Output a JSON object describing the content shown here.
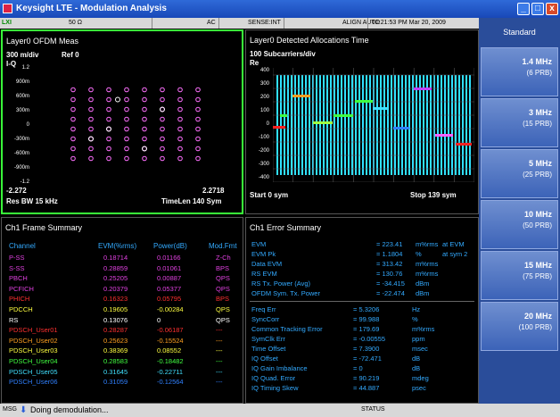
{
  "title": "Keysight LTE - Modulation Analysis",
  "status_bar": {
    "indicator": "LXI",
    "impedance": "50 Ω",
    "coupling": "AC",
    "sense": "SENSE:INT",
    "align": "ALIGN AUTO",
    "datetime": "01:21:53 PM Mar 20, 2009"
  },
  "window_buttons": [
    "_",
    "□",
    "x"
  ],
  "panel1": {
    "title": "Layer0 OFDM Meas",
    "scale": "300 m/div",
    "ref": "Ref 0",
    "axis": "I-Q",
    "yticks": [
      "1.2",
      "900m",
      "600m",
      "300m",
      "0",
      "-300m",
      "-600m",
      "-900m",
      "-1.2"
    ],
    "x_start": "-2.272",
    "x_stop": "2.2718",
    "res_bw": "Res BW 15 kHz",
    "time_len": "TimeLen 140  Sym"
  },
  "panel2": {
    "title": "Layer0 Detected Allocations Time",
    "scale": "100  Subcarriers/div",
    "axis": "Re",
    "yticks": [
      "400",
      "300",
      "200",
      "100",
      "0",
      "-100",
      "-200",
      "-300",
      "-400"
    ],
    "start": "Start 0  sym",
    "stop": "Stop 139  sym"
  },
  "panel3": {
    "title": "Ch1 Frame Summary",
    "headers": [
      "Channel",
      "EVM(%rms)",
      "Power(dB)",
      "Mod.Fmt"
    ],
    "rows": [
      {
        "channel": "P-SS",
        "evm": "0.18714",
        "power": "0.01166",
        "mod": "Z-Ch",
        "color": "#e040e0"
      },
      {
        "channel": "S-SS",
        "evm": "0.28859",
        "power": "0.01061",
        "mod": "BPS",
        "color": "#e040e0"
      },
      {
        "channel": "PBCH",
        "evm": "0.25205",
        "power": "0.00887",
        "mod": "QPS",
        "color": "#e040e0"
      },
      {
        "channel": "PCFICH",
        "evm": "0.20379",
        "power": "0.05377",
        "mod": "QPS",
        "color": "#e040e0"
      },
      {
        "channel": "PHICH",
        "evm": "0.16323",
        "power": "0.05795",
        "mod": "BPS",
        "color": "#ff3030"
      },
      {
        "channel": "PDCCH",
        "evm": "0.19605",
        "power": "-0.00284",
        "mod": "QPS",
        "color": "#ffff40"
      },
      {
        "channel": "RS",
        "evm": "0.13076",
        "power": "0",
        "mod": "QPS",
        "color": "#ffffff"
      },
      {
        "channel": "PDSCH_User01",
        "evm": "0.28287",
        "power": "-0.06187",
        "mod": "---",
        "color": "#ff3030"
      },
      {
        "channel": "PDSCH_User02",
        "evm": "0.25623",
        "power": "-0.15524",
        "mod": "---",
        "color": "#ffa020"
      },
      {
        "channel": "PDSCH_User03",
        "evm": "0.38369",
        "power": "0.08552",
        "mod": "---",
        "color": "#ffff40"
      },
      {
        "channel": "PDSCH_User04",
        "evm": "0.28583",
        "power": "-0.18482",
        "mod": "---",
        "color": "#40ff40"
      },
      {
        "channel": "PDSCH_User05",
        "evm": "0.31645",
        "power": "-0.22711",
        "mod": "---",
        "color": "#40e0ff"
      },
      {
        "channel": "PDSCH_User06",
        "evm": "0.31059",
        "power": "-0.12564",
        "mod": "---",
        "color": "#3080ff"
      }
    ]
  },
  "panel4": {
    "title": "Ch1 Error Summary",
    "group1": [
      {
        "name": "EVM",
        "value": "= 223.41",
        "unit": "m%rms",
        "extra": "at   EVM"
      },
      {
        "name": "EVM Pk",
        "value": "= 1.1804",
        "unit": "%",
        "extra": "at  sym 2"
      },
      {
        "name": "Data EVM",
        "value": "= 313.42",
        "unit": "m%rms",
        "extra": ""
      },
      {
        "name": "RS EVM",
        "value": "= 130.76",
        "unit": "m%rms",
        "extra": ""
      },
      {
        "name": "RS Tx. Power (Avg)",
        "value": "= -34.415",
        "unit": "dBm",
        "extra": ""
      },
      {
        "name": "OFDM Sym. Tx. Power",
        "value": "= -22.474",
        "unit": "dBm",
        "extra": ""
      }
    ],
    "group2": [
      {
        "name": "Freq Err",
        "value": "= 5.3206",
        "unit": "Hz"
      },
      {
        "name": "SyncCorr",
        "value": "= 99.988",
        "unit": "%"
      },
      {
        "name": "Common Tracking Error",
        "value": "= 179.69",
        "unit": "m%rms"
      },
      {
        "name": "SymClk Err",
        "value": "= -0.00555",
        "unit": "ppm"
      },
      {
        "name": "Time Offset",
        "value": "= 7.3900",
        "unit": "msec"
      },
      {
        "name": "IQ Offset",
        "value": "= -72.471",
        "unit": "dB"
      },
      {
        "name": "IQ Gain Imbalance",
        "value": "= 0",
        "unit": "dB"
      },
      {
        "name": "IQ Quad. Error",
        "value": "= 90.219",
        "unit": "mdeg"
      },
      {
        "name": "IQ Timing Skew",
        "value": "= 44.887",
        "unit": "psec"
      }
    ]
  },
  "softkeys": {
    "header": "Standard",
    "items": [
      {
        "label": "1.4 MHz",
        "sub": "(6 PRB)"
      },
      {
        "label": "3 MHz",
        "sub": "(15 PRB)"
      },
      {
        "label": "5 MHz",
        "sub": "(25 PRB)"
      },
      {
        "label": "10 MHz",
        "sub": "(50 PRB)"
      },
      {
        "label": "15 MHz",
        "sub": "(75 PRB)"
      },
      {
        "label": "20 MHz",
        "sub": "(100 PRB)"
      }
    ]
  },
  "message_bar": {
    "msg": "MSG",
    "text": "Doing demodulation...",
    "status": "STATUS"
  },
  "colors": {
    "accent": "#39ff39",
    "softkey": "#3c63b8",
    "constellation": "#ff60ff",
    "allocation_bg": "#30e0ff"
  }
}
